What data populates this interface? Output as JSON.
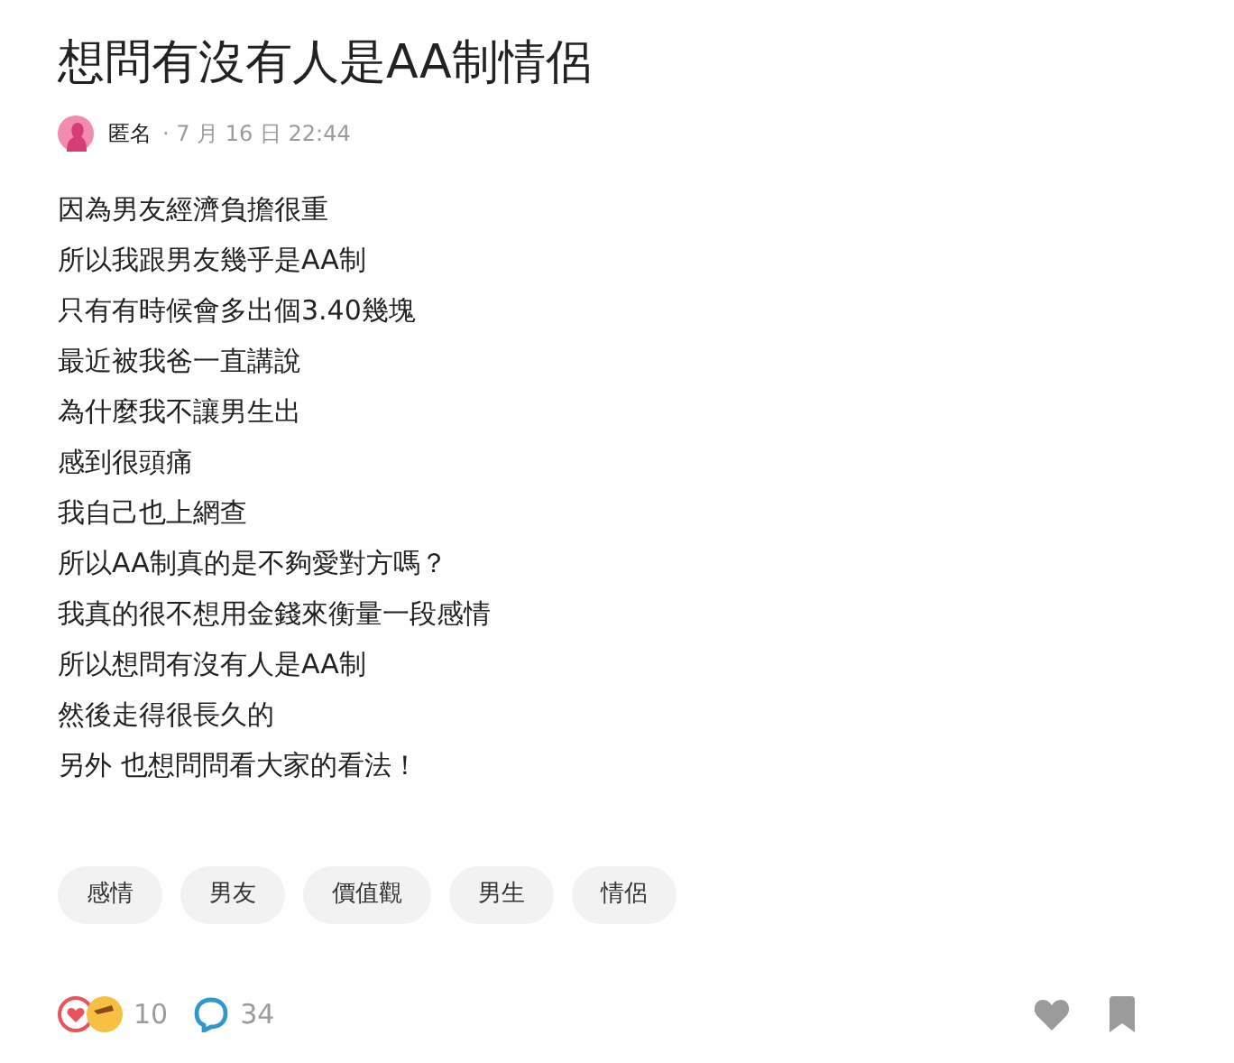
{
  "title": "想問有沒有人是AA制情侶",
  "author": {
    "name": "匿名",
    "date": "· 7 月 16 日 22:44"
  },
  "body": [
    "因為男友經濟負擔很重",
    "所以我跟男友幾乎是AA制",
    "只有有時候會多出個3.40幾塊",
    "最近被我爸一直講說",
    "為什麼我不讓男生出",
    "感到很頭痛",
    "我自己也上網查",
    "所以AA制真的是不夠愛對方嗎？",
    "我真的很不想用金錢來衡量一段感情",
    "所以想問有沒有人是AA制",
    "然後走得很長久的",
    "另外 也想問問看大家的看法！"
  ],
  "tags": [
    "感情",
    "男友",
    "價值觀",
    "男生",
    "情侶"
  ],
  "footer": {
    "reactions": "10",
    "comments": "34"
  }
}
